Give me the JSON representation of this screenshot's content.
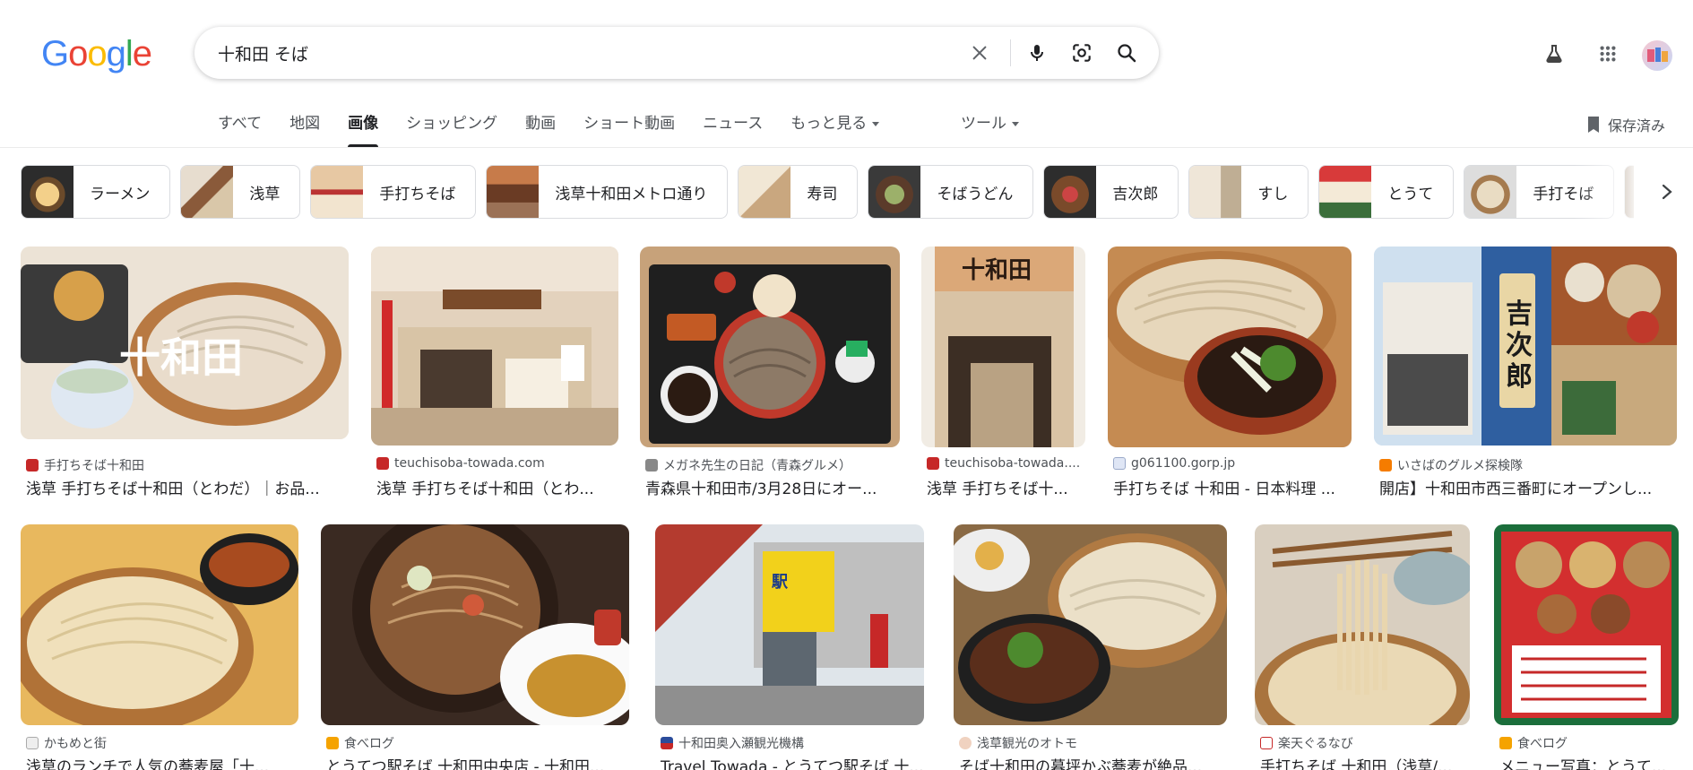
{
  "logo": "Google",
  "search": {
    "value": "十和田 そば"
  },
  "tabs": [
    {
      "label": "すべて",
      "active": false
    },
    {
      "label": "地図",
      "active": false
    },
    {
      "label": "画像",
      "active": true
    },
    {
      "label": "ショッピング",
      "active": false
    },
    {
      "label": "動画",
      "active": false
    },
    {
      "label": "ショート動画",
      "active": false
    },
    {
      "label": "ニュース",
      "active": false
    },
    {
      "label": "もっと見る",
      "active": false
    }
  ],
  "tools_label": "ツール",
  "saved_label": "保存済み",
  "chips": [
    {
      "label": "ラーメン"
    },
    {
      "label": "浅草"
    },
    {
      "label": "手打ちそば"
    },
    {
      "label": "浅草十和田メトロ通り"
    },
    {
      "label": "寿司"
    },
    {
      "label": "そばうどん"
    },
    {
      "label": "吉次郎"
    },
    {
      "label": "すし"
    },
    {
      "label": "とうて"
    },
    {
      "label": "手打そば"
    },
    {
      "label": ""
    }
  ],
  "results": [
    {
      "source": "手打ちそば十和田",
      "title": "浅草 手打ちそば十和田（とわだ）｜お品..."
    },
    {
      "source": "teuchisoba-towada.com",
      "title": "浅草 手打ちそば十和田（とわ..."
    },
    {
      "source": "メガネ先生の日記（青森グルメ）",
      "title": "青森県十和田市/3月28日にオー..."
    },
    {
      "source": "teuchisoba-towada....",
      "title": "浅草 手打ちそば十..."
    },
    {
      "source": "g061100.gorp.jp",
      "title": "手打ちそば 十和田 - 日本料理 ..."
    },
    {
      "source": "いさばのグルメ探検隊",
      "title": "開店】十和田市西三番町にオープンし..."
    },
    {
      "source": "かもめと街",
      "title": "浅草のランチで人気の蕎麦屋「十..."
    },
    {
      "source": "食べログ",
      "title": "とうてつ駅そば 十和田中央店 - 十和田..."
    },
    {
      "source": "十和田奥入瀬観光機構",
      "title": "Travel Towada - とうてつ駅そば 十..."
    },
    {
      "source": "浅草観光のオトモ",
      "title": "そば十和田の暮坪かぶ蕎麦が絶品..."
    },
    {
      "source": "楽天ぐるなび",
      "title": "手打ちそば 十和田（浅草/..."
    },
    {
      "source": "食べログ",
      "title": "メニュー写真：とうて..."
    }
  ],
  "colors": {
    "google_blue": "#4285F4",
    "google_red": "#EA4335",
    "google_yellow": "#FBBC05",
    "google_green": "#34A853"
  }
}
